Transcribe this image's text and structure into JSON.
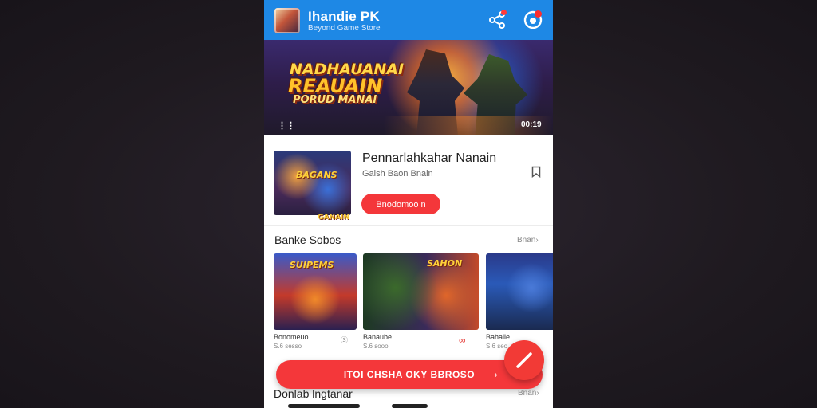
{
  "header": {
    "title": "Ihandie PK",
    "subtitle": "Beyond Game Store"
  },
  "hero": {
    "line1": "NADHAUANAI",
    "line2": "REAUAIN",
    "line3": "PORUD MANAI",
    "counter": "00:19",
    "expand_glyph": "⋮⋮"
  },
  "featured": {
    "title": "Pennarlahkahar Nanain",
    "subtitle": "Gaish Baon Bnain",
    "button_label": "Bnodomoo n",
    "thumb_title": "BAGANS",
    "thumb_foot": "GANAIN"
  },
  "section": {
    "title": "Banke Sobos",
    "more_label": "Bnan"
  },
  "games": [
    {
      "name": "Bonomeuo",
      "meta": "S.6 sesso",
      "status": "Ⓢ",
      "thumb_title": "SUIPEMS",
      "status_color": "#888888"
    },
    {
      "name": "Banaube",
      "meta": "S.6 sooo",
      "status": "∞",
      "thumb_title": "SAHON",
      "status_color": "#e53935"
    },
    {
      "name": "Bahaiie",
      "meta": "S.6 seo",
      "status": "",
      "thumb_title": "",
      "status_color": "#888888"
    }
  ],
  "cta": {
    "label": "ITOI CHSHA OKY BBROSO",
    "chevron": "›"
  },
  "bottom_section": {
    "title": "Donlab lngtanar",
    "more_label": "Bnan"
  },
  "colors": {
    "header_blue": "#1e88e5",
    "accent_red": "#f4373a",
    "page_bg": "#211c22"
  }
}
